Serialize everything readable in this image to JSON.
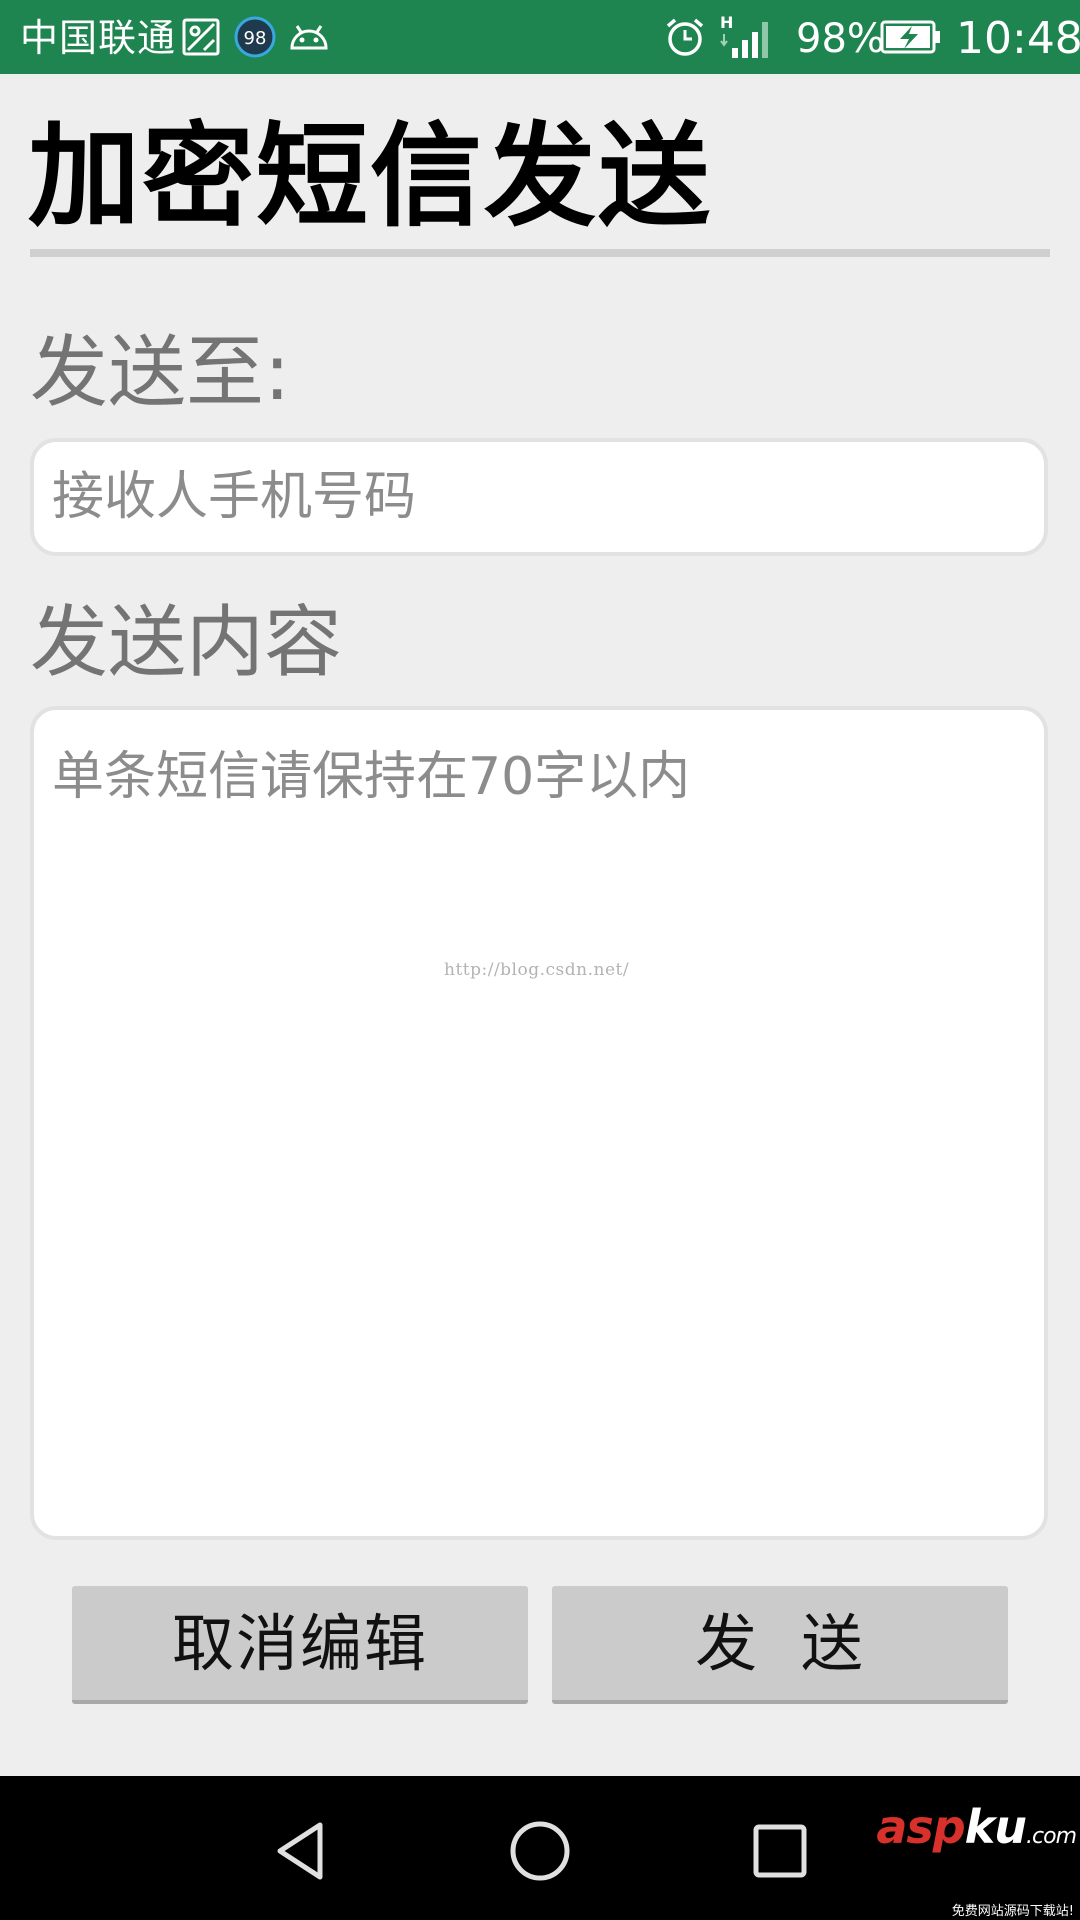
{
  "status_bar": {
    "carrier": "中国联通",
    "notification_badge": "98",
    "network_type": "H",
    "battery_percent": "98%",
    "time": "10:48",
    "icons": [
      "gallery-icon",
      "badge-icon",
      "android-icon",
      "alarm-icon",
      "signal-icon",
      "battery-charging-icon"
    ]
  },
  "page": {
    "title": "加密短信发送"
  },
  "recipient": {
    "label": "发送至:",
    "placeholder": "接收人手机号码"
  },
  "message": {
    "label": "发送内容",
    "placeholder": "单条短信请保持在70字以内"
  },
  "watermark": "http://blog.csdn.net/",
  "buttons": {
    "cancel": "取消编辑",
    "send": "发 送"
  },
  "nav": {
    "icons": [
      "back-icon",
      "home-icon",
      "recents-icon"
    ]
  },
  "site_logo": {
    "text": "aspku.com",
    "tagline": "免费网站源码下载站!"
  },
  "colors": {
    "status_bar": "#1f8550",
    "background": "#eeeeee",
    "button": "#cbcbcb",
    "label": "#747474",
    "logo_red": "#d8312b"
  }
}
